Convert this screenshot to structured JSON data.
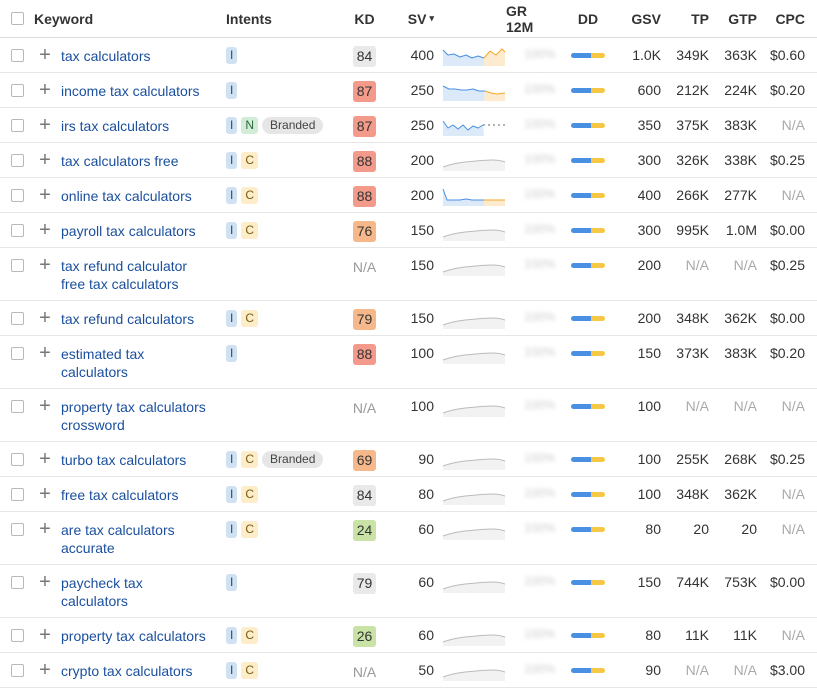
{
  "header": {
    "keyword": "Keyword",
    "intents": "Intents",
    "kd": "KD",
    "sv": "SV",
    "sv_sort_icon": "▾",
    "gr": "GR 12M",
    "dd": "DD",
    "gsv": "GSV",
    "tp": "TP",
    "gtp": "GTP",
    "cpc": "CPC"
  },
  "colors": {
    "kd_gray": "#e9e9e9",
    "kd_red": "#f39a8a",
    "kd_orange": "#f6b88a",
    "kd_green": "#c9e2a5",
    "link": "#1a4f9e",
    "dd_blue": "#4a90e2",
    "dd_yellow": "#f6c744"
  },
  "rows": [
    {
      "kw": [
        "tax calculators"
      ],
      "intents": [
        "I"
      ],
      "kd": "84",
      "kd_color": "#e9e9e9",
      "sv": "400",
      "spark": "trend_a",
      "gr": "100%",
      "gsv": "1.0K",
      "tp": "349K",
      "gtp": "363K",
      "cpc": "$0.60"
    },
    {
      "kw": [
        "income tax calculators"
      ],
      "intents": [
        "I"
      ],
      "kd": "87",
      "kd_color": "#f39a8a",
      "sv": "250",
      "spark": "trend_b",
      "gr": "100%",
      "gsv": "600",
      "tp": "212K",
      "gtp": "224K",
      "cpc": "$0.20"
    },
    {
      "kw": [
        "irs tax calculators"
      ],
      "intents": [
        "I",
        "N",
        "Branded"
      ],
      "kd": "87",
      "kd_color": "#f39a8a",
      "sv": "250",
      "spark": "trend_c",
      "gr": "100%",
      "gsv": "350",
      "tp": "375K",
      "gtp": "383K",
      "cpc": "N/A"
    },
    {
      "kw": [
        "tax calculators free"
      ],
      "intents": [
        "I",
        "C"
      ],
      "kd": "88",
      "kd_color": "#f39a8a",
      "sv": "200",
      "spark": "wave",
      "gr": "100%",
      "gsv": "300",
      "tp": "326K",
      "gtp": "338K",
      "cpc": "$0.25"
    },
    {
      "kw": [
        "online tax calculators"
      ],
      "intents": [
        "I",
        "C"
      ],
      "kd": "88",
      "kd_color": "#f39a8a",
      "sv": "200",
      "spark": "trend_d",
      "gr": "100%",
      "gsv": "400",
      "tp": "266K",
      "gtp": "277K",
      "cpc": "N/A"
    },
    {
      "kw": [
        "payroll tax calculators"
      ],
      "intents": [
        "I",
        "C"
      ],
      "kd": "76",
      "kd_color": "#f6b88a",
      "sv": "150",
      "spark": "wave",
      "gr": "100%",
      "gsv": "300",
      "tp": "995K",
      "gtp": "1.0M",
      "cpc": "$0.00"
    },
    {
      "kw": [
        "tax refund calculator",
        "free tax calculators"
      ],
      "intents": [],
      "kd": "N/A",
      "kd_color": "",
      "sv": "150",
      "spark": "wave",
      "gr": "100%",
      "gsv": "200",
      "tp": "N/A",
      "gtp": "N/A",
      "cpc": "$0.25"
    },
    {
      "kw": [
        "tax refund calculators"
      ],
      "intents": [
        "I",
        "C"
      ],
      "kd": "79",
      "kd_color": "#f6b88a",
      "sv": "150",
      "spark": "wave",
      "gr": "100%",
      "gsv": "200",
      "tp": "348K",
      "gtp": "362K",
      "cpc": "$0.00"
    },
    {
      "kw": [
        "estimated tax",
        "calculators"
      ],
      "intents": [
        "I"
      ],
      "kd": "88",
      "kd_color": "#f39a8a",
      "sv": "100",
      "spark": "wave",
      "gr": "100%",
      "gsv": "150",
      "tp": "373K",
      "gtp": "383K",
      "cpc": "$0.20"
    },
    {
      "kw": [
        "property tax calculators",
        "crossword"
      ],
      "intents": [],
      "kd": "N/A",
      "kd_color": "",
      "sv": "100",
      "spark": "wave",
      "gr": "100%",
      "gsv": "100",
      "tp": "N/A",
      "gtp": "N/A",
      "cpc": "N/A"
    },
    {
      "kw": [
        "turbo tax calculators"
      ],
      "intents": [
        "I",
        "C",
        "Branded"
      ],
      "kd": "69",
      "kd_color": "#f6b88a",
      "sv": "90",
      "spark": "wave",
      "gr": "100%",
      "gsv": "100",
      "tp": "255K",
      "gtp": "268K",
      "cpc": "$0.25"
    },
    {
      "kw": [
        "free tax calculators"
      ],
      "intents": [
        "I",
        "C"
      ],
      "kd": "84",
      "kd_color": "#e9e9e9",
      "sv": "80",
      "spark": "wave",
      "gr": "100%",
      "gsv": "100",
      "tp": "348K",
      "gtp": "362K",
      "cpc": "N/A"
    },
    {
      "kw": [
        "are tax calculators",
        "accurate"
      ],
      "intents": [
        "I",
        "C"
      ],
      "kd": "24",
      "kd_color": "#c9e2a5",
      "sv": "60",
      "spark": "wave",
      "gr": "100%",
      "gsv": "80",
      "tp": "20",
      "gtp": "20",
      "cpc": "N/A"
    },
    {
      "kw": [
        "paycheck tax",
        "calculators"
      ],
      "intents": [
        "I"
      ],
      "kd": "79",
      "kd_color": "#e9e9e9",
      "sv": "60",
      "spark": "wave",
      "gr": "100%",
      "gsv": "150",
      "tp": "744K",
      "gtp": "753K",
      "cpc": "$0.00"
    },
    {
      "kw": [
        "property tax calculators"
      ],
      "intents": [
        "I",
        "C"
      ],
      "kd": "26",
      "kd_color": "#c9e2a5",
      "sv": "60",
      "spark": "wave",
      "gr": "100%",
      "gsv": "80",
      "tp": "11K",
      "gtp": "11K",
      "cpc": "N/A"
    },
    {
      "kw": [
        "crypto tax calculators"
      ],
      "intents": [
        "I",
        "C"
      ],
      "kd": "N/A",
      "kd_color": "",
      "sv": "50",
      "spark": "wave",
      "gr": "100%",
      "gsv": "90",
      "tp": "N/A",
      "gtp": "N/A",
      "cpc": "$3.00"
    }
  ]
}
